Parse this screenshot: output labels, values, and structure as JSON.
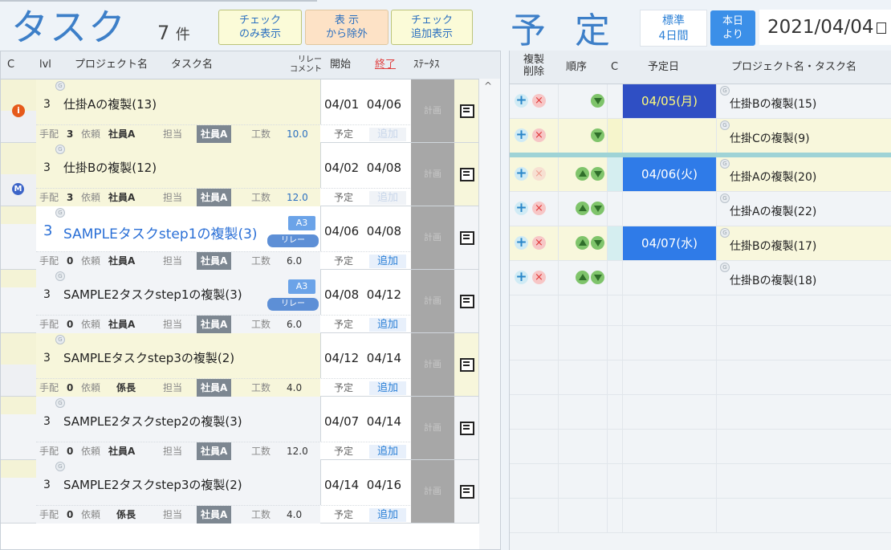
{
  "header": {
    "title_tasks": "タスク",
    "count": "7",
    "count_unit": "件",
    "btn_check_only": [
      "チェック",
      "のみ表示"
    ],
    "btn_exclude": [
      "表 示",
      "から除外"
    ],
    "btn_check_add": [
      "チェック",
      "追加表示"
    ],
    "title_schedule": "予定",
    "std_btn": [
      "標準",
      "4日間"
    ],
    "today_btn": [
      "本日",
      "より"
    ],
    "date": "2021/04/04"
  },
  "left_table": {
    "columns": {
      "c": "C",
      "lvl": "lvl",
      "project": "プロジェクト名",
      "task": "タスク名",
      "relay_comment": [
        "リレー",
        "コメント"
      ],
      "start": "開始",
      "end": "終了",
      "status": "ｽﾃｰﾀｽ"
    },
    "sub_labels": {
      "tehai": "手配",
      "irai": "依頼",
      "tantou": "担当",
      "kousu": "工数",
      "yotei": "予定",
      "add": "追加",
      "status": "計画"
    },
    "rows": [
      {
        "lvl": "3",
        "name": "仕掛Aの複製(13)",
        "start": "04/01",
        "end": "04/06",
        "tehai": "3",
        "irai": "社員A",
        "tantou": "社員A",
        "kousu": "10.0"
      },
      {
        "lvl": "3",
        "name": "仕掛Bの複製(12)",
        "start": "04/02",
        "end": "04/08",
        "tehai": "3",
        "irai": "社員A",
        "tantou": "社員A",
        "kousu": "12.0"
      },
      {
        "lvl": "3",
        "name": "SAMPLEタスクstep1の複製(3)",
        "start": "04/06",
        "end": "04/08",
        "tehai": "0",
        "irai": "社員A",
        "tantou": "社員A",
        "kousu": "6.0",
        "tag": "A3",
        "relay": "リレー"
      },
      {
        "lvl": "3",
        "name": "SAMPLE2タスクstep1の複製(3)",
        "start": "04/08",
        "end": "04/12",
        "tehai": "0",
        "irai": "社員A",
        "tantou": "社員A",
        "kousu": "6.0",
        "tag": "A3",
        "relay": "リレー"
      },
      {
        "lvl": "3",
        "name": "SAMPLEタスクstep3の複製(2)",
        "start": "04/12",
        "end": "04/14",
        "tehai": "0",
        "irai": "係長",
        "tantou": "社員A",
        "kousu": "4.0"
      },
      {
        "lvl": "3",
        "name": "SAMPLE2タスクstep2の複製(3)",
        "start": "04/07",
        "end": "04/14",
        "tehai": "0",
        "irai": "社員A",
        "tantou": "社員A",
        "kousu": "12.0"
      },
      {
        "lvl": "3",
        "name": "SAMPLE2タスクstep3の複製(2)",
        "start": "04/14",
        "end": "04/16",
        "tehai": "0",
        "irai": "係長",
        "tantou": "社員A",
        "kousu": "4.0"
      }
    ]
  },
  "right_table": {
    "columns": {
      "dup_delete": [
        "複製",
        "削除"
      ],
      "order": "順序",
      "c": "C",
      "date": "予定日",
      "name": "プロジェクト名・タスク名"
    },
    "rows": [
      {
        "date": "04/05(月)",
        "name": "仕掛Bの複製(15)"
      },
      {
        "date": "",
        "name": "仕掛Cの複製(9)"
      },
      {
        "date": "04/06(火)",
        "name": "仕掛Aの複製(20)"
      },
      {
        "date": "",
        "name": "仕掛Aの複製(22)"
      },
      {
        "date": "04/07(水)",
        "name": "仕掛Bの複製(17)"
      },
      {
        "date": "",
        "name": "仕掛Bの複製(18)"
      }
    ]
  },
  "icons": {
    "g_mark": "G",
    "warn": "i",
    "m_mark": "M",
    "plus": "+",
    "cross": "×",
    "scroll_up": "^"
  }
}
